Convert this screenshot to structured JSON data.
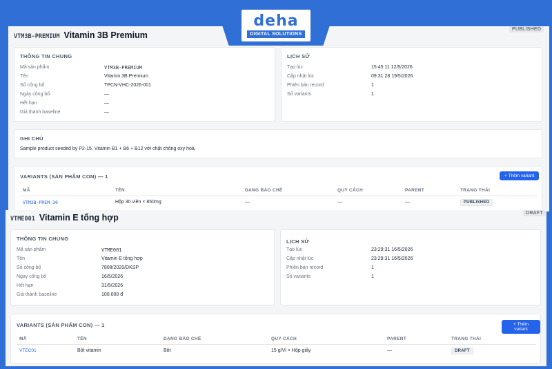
{
  "brand": {
    "logo_word": "deha",
    "logo_sub": "DIGITAL SOLUTIONS"
  },
  "product_a": {
    "sku": "VTM3B-PREMIUM",
    "title": "Vitamin 3B Premium",
    "status": "PUBLISHED",
    "general": {
      "heading": "THÔNG TIN CHUNG",
      "rows": [
        {
          "label": "Mã sản phẩm",
          "value": "VTM3B-PREMIUM"
        },
        {
          "label": "Tên",
          "value": "Vitamin 3B Premium"
        },
        {
          "label": "Số công bố",
          "value": "TPCN-VHC-2026-001"
        },
        {
          "label": "Ngày công bố",
          "value": "—"
        },
        {
          "label": "Hết hạn",
          "value": "—"
        },
        {
          "label": "Giá thành baseline",
          "value": "—"
        }
      ]
    },
    "history": {
      "heading": "LỊCH SỬ",
      "rows": [
        {
          "label": "Tạo lúc",
          "value": "15:45:11 12/5/2026"
        },
        {
          "label": "Cập nhật lúc",
          "value": "09:31:28 19/5/2026"
        },
        {
          "label": "Phiên bản record",
          "value": "1"
        },
        {
          "label": "Số variants",
          "value": "1"
        }
      ]
    },
    "note": {
      "heading": "GHI CHÚ",
      "text": "Sample product seeded by P2-15. Vitamin B1 + B6 + B12 với chất chống oxy hoá."
    },
    "variants": {
      "heading": "VARIANTS (SẢN PHẨM CON) — 1",
      "add_label": "+ Thêm variant",
      "columns": [
        "MÃ",
        "TÊN",
        "DẠNG BÀO CHẾ",
        "QUY CÁCH",
        "PARENT",
        "TRẠNG THÁI"
      ],
      "rows": [
        {
          "code": "VTM3B-PREM-30",
          "name": "Hộp 30 viên × 850mg",
          "form": "—",
          "spec": "—",
          "parent": "—",
          "status": "PUBLISHED"
        }
      ]
    }
  },
  "product_b": {
    "sku": "VTME001",
    "title": "Vitamin E tổng hợp",
    "status": "DRAFT",
    "general": {
      "heading": "THÔNG TIN CHUNG",
      "rows": [
        {
          "label": "Mã sản phẩm",
          "value": "VTME001"
        },
        {
          "label": "Tên",
          "value": "Vitamin E tổng hợp"
        },
        {
          "label": "Số công bố",
          "value": "7808/2020/DKSP"
        },
        {
          "label": "Ngày công bố",
          "value": "16/5/2026"
        },
        {
          "label": "Hết hạn",
          "value": "31/5/2026"
        },
        {
          "label": "Giá thành baseline",
          "value": "100.000 đ"
        }
      ]
    },
    "history": {
      "heading": "LỊCH SỬ",
      "rows": [
        {
          "label": "Tạo lúc",
          "value": "23:29:31 16/5/2026"
        },
        {
          "label": "Cập nhật lúc",
          "value": "23:29:31 16/5/2026"
        },
        {
          "label": "Phiên bản record",
          "value": "1"
        },
        {
          "label": "Số variants",
          "value": "1"
        }
      ]
    },
    "variants": {
      "heading": "VARIANTS (SẢN PHẨM CON) — 1",
      "add_label": "+ Thêm variant",
      "columns": [
        "MÃ",
        "TÊN",
        "DẠNG BÀO CHẾ",
        "QUY CÁCH",
        "PARENT",
        "TRẠNG THÁI"
      ],
      "rows": [
        {
          "code": "VTEC01",
          "name": "Bột vitamin",
          "form": "Bột",
          "spec": "15 g/Vỉ × Hộp giấy",
          "parent": "—",
          "status": "DRAFT"
        }
      ]
    }
  }
}
